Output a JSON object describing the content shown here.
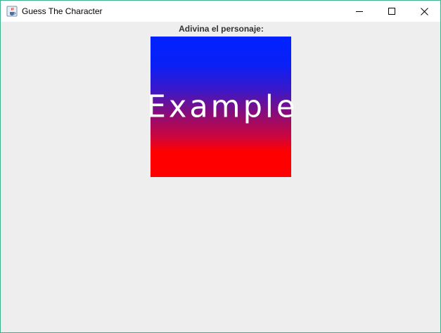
{
  "window": {
    "title": "Guess The Character",
    "icon": "java-cup-icon"
  },
  "titlebar_buttons": {
    "minimize_icon": "minimize-icon",
    "maximize_icon": "maximize-icon",
    "close_icon": "close-icon"
  },
  "main": {
    "prompt": "Adivina el personaje:",
    "image_text": "Example",
    "image_gradient": {
      "top_color": "#0022ff",
      "bottom_color": "#ff0000"
    }
  },
  "colors": {
    "window_border": "#3cb38a",
    "background": "#eeeeee"
  }
}
